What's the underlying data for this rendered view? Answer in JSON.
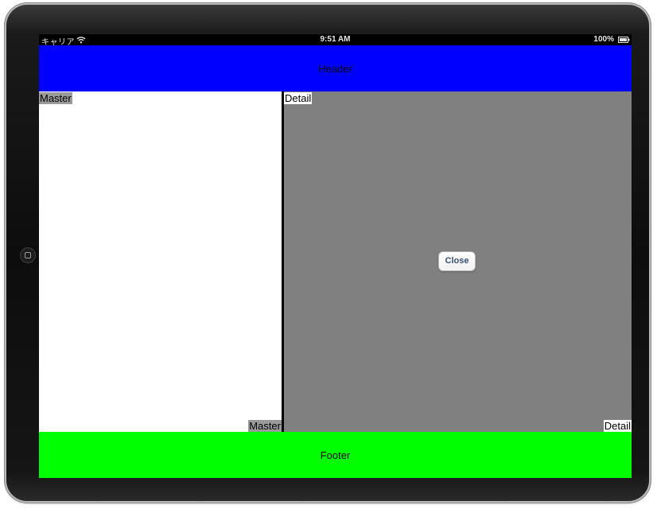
{
  "status_bar": {
    "carrier": "キャリア",
    "time": "9:51 AM",
    "battery": "100%"
  },
  "header": {
    "title": "Header"
  },
  "master": {
    "top_label": "Master",
    "bottom_label": "Master"
  },
  "detail": {
    "top_label": "Detail",
    "bottom_label": "Detail",
    "close_label": "Close"
  },
  "footer": {
    "title": "Footer"
  },
  "colors": {
    "header_bg": "#0000ff",
    "footer_bg": "#00ff00",
    "master_bg": "#ffffff",
    "detail_bg": "#808080",
    "close_text": "#3a4f7a"
  },
  "icons": [
    "wifi-icon",
    "battery-icon",
    "home-button-icon"
  ]
}
